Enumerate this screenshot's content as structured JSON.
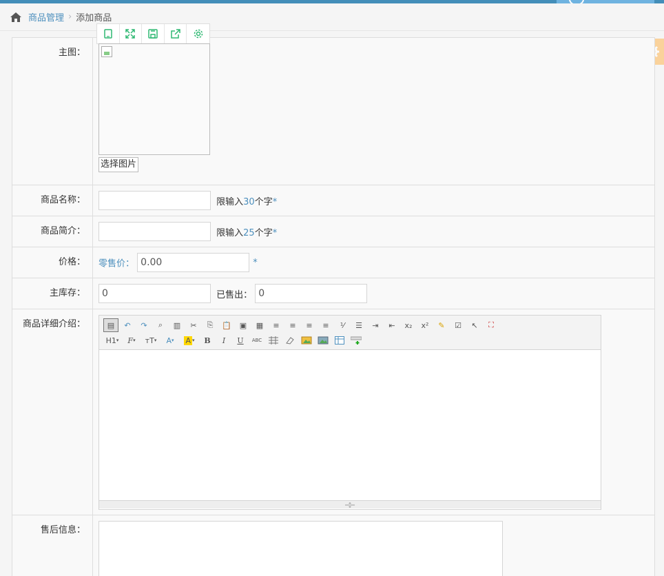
{
  "breadcrumb": {
    "parent": "商品管理",
    "separator": "›",
    "current": "添加商品"
  },
  "form": {
    "main_image_label": "主图：",
    "choose_image": "选择图片",
    "name_label": "商品名称：",
    "name_value": "",
    "name_hint_prefix": "限输入",
    "name_hint_num": "30",
    "name_hint_suffix": "个字",
    "required_mark": "*",
    "intro_label": "商品简介：",
    "intro_value": "",
    "intro_hint_prefix": "限输入",
    "intro_hint_num": "25",
    "intro_hint_suffix": "个字",
    "price_label": "价格：",
    "retail_price_label": "零售价：",
    "retail_price_value": "0.00",
    "stock_label": "主库存：",
    "stock_value": "0",
    "sold_label": "已售出：",
    "sold_value": "0",
    "detail_label": "商品详细介绍：",
    "after_sale_label": "售后信息："
  },
  "editor": {
    "row1": [
      "source",
      "undo",
      "redo",
      "preview",
      "template",
      "cut",
      "copy",
      "paste",
      "paste-plain",
      "paste-word",
      "align-left",
      "align-center",
      "align-right",
      "justify",
      "ordered-list",
      "unordered-list",
      "indent",
      "outdent",
      "subscript",
      "superscript",
      "format-painter",
      "select-all",
      "cursor",
      "fullscreen"
    ],
    "row2_labels": {
      "heading": "H1",
      "fontname": "F",
      "fontsize": "тT",
      "forecolor": "A",
      "hilitecolor": "A",
      "bold": "B",
      "italic": "I",
      "underline": "U",
      "strike": "ABC"
    }
  }
}
